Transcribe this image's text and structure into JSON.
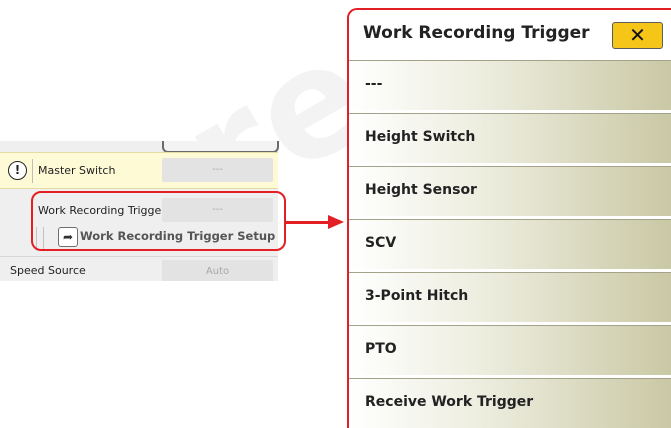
{
  "watermark": "ure",
  "settings": {
    "master_switch": {
      "label": "Master Switch",
      "value": "---"
    },
    "work_recording_trigger": {
      "label": "Work Recording Trigger",
      "value": "---"
    },
    "setup_link": {
      "label": "Work Recording Trigger Setup"
    },
    "speed_source": {
      "label": "Speed Source",
      "value": "Auto"
    }
  },
  "dialog": {
    "title": "Work Recording Trigger",
    "close_symbol": "✕",
    "options": [
      {
        "label": "---"
      },
      {
        "label": "Height Switch"
      },
      {
        "label": "Height Sensor"
      },
      {
        "label": "SCV"
      },
      {
        "label": "3-Point Hitch"
      },
      {
        "label": "PTO"
      },
      {
        "label": "Receive Work Trigger"
      }
    ]
  },
  "colors": {
    "highlight": "#e31e24",
    "close_button": "#f5c518",
    "warning_row": "#fffad6"
  },
  "icons": {
    "warning": "exclamation-circle-icon",
    "setup": "share-arrow-icon",
    "close": "close-icon"
  }
}
